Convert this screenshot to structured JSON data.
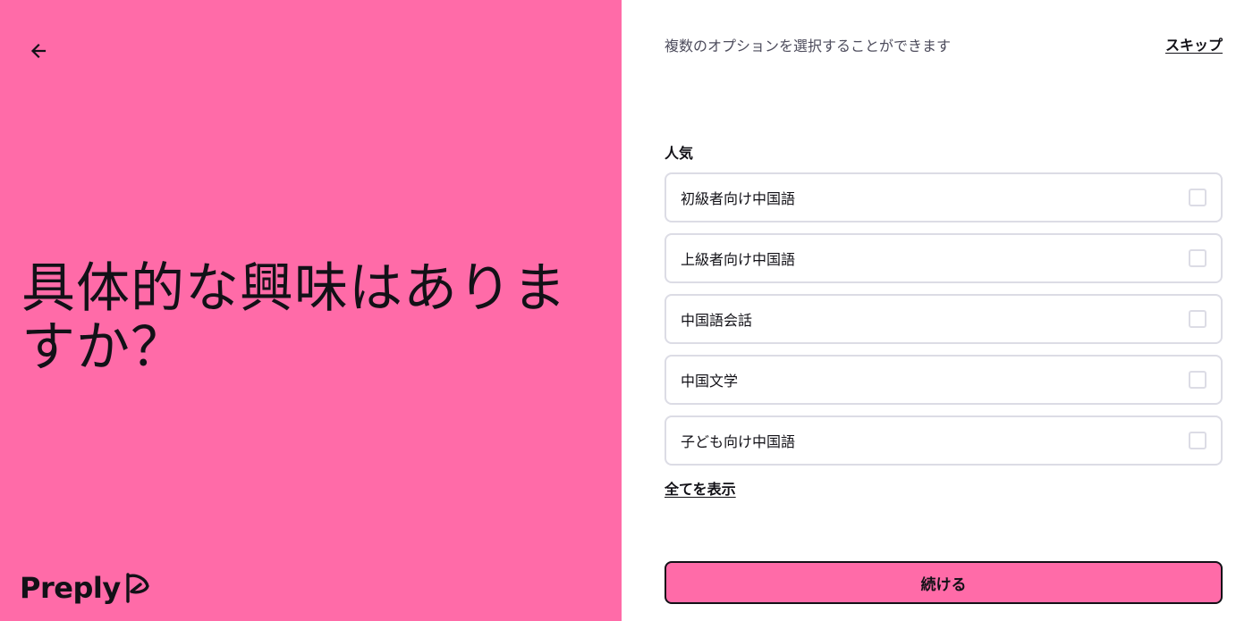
{
  "colors": {
    "brand_pink": "#ff6ba8",
    "text_dark": "#121117",
    "border_gray": "#dcdce5"
  },
  "left": {
    "back_icon": "arrow-left-icon",
    "headline": "具体的な興味はありますか？",
    "logo_text": "Preply",
    "logo_icon": "preply-flag-icon"
  },
  "right": {
    "hint": "複数のオプションを選択することができます",
    "skip_label": "スキップ",
    "section_title": "人気",
    "options": [
      {
        "label": "初級者向け中国語",
        "checked": false
      },
      {
        "label": "上級者向け中国語",
        "checked": false
      },
      {
        "label": "中国語会話",
        "checked": false
      },
      {
        "label": "中国文学",
        "checked": false
      },
      {
        "label": "子ども向け中国語",
        "checked": false
      }
    ],
    "show_all_label": "全てを表示",
    "continue_label": "続ける"
  }
}
